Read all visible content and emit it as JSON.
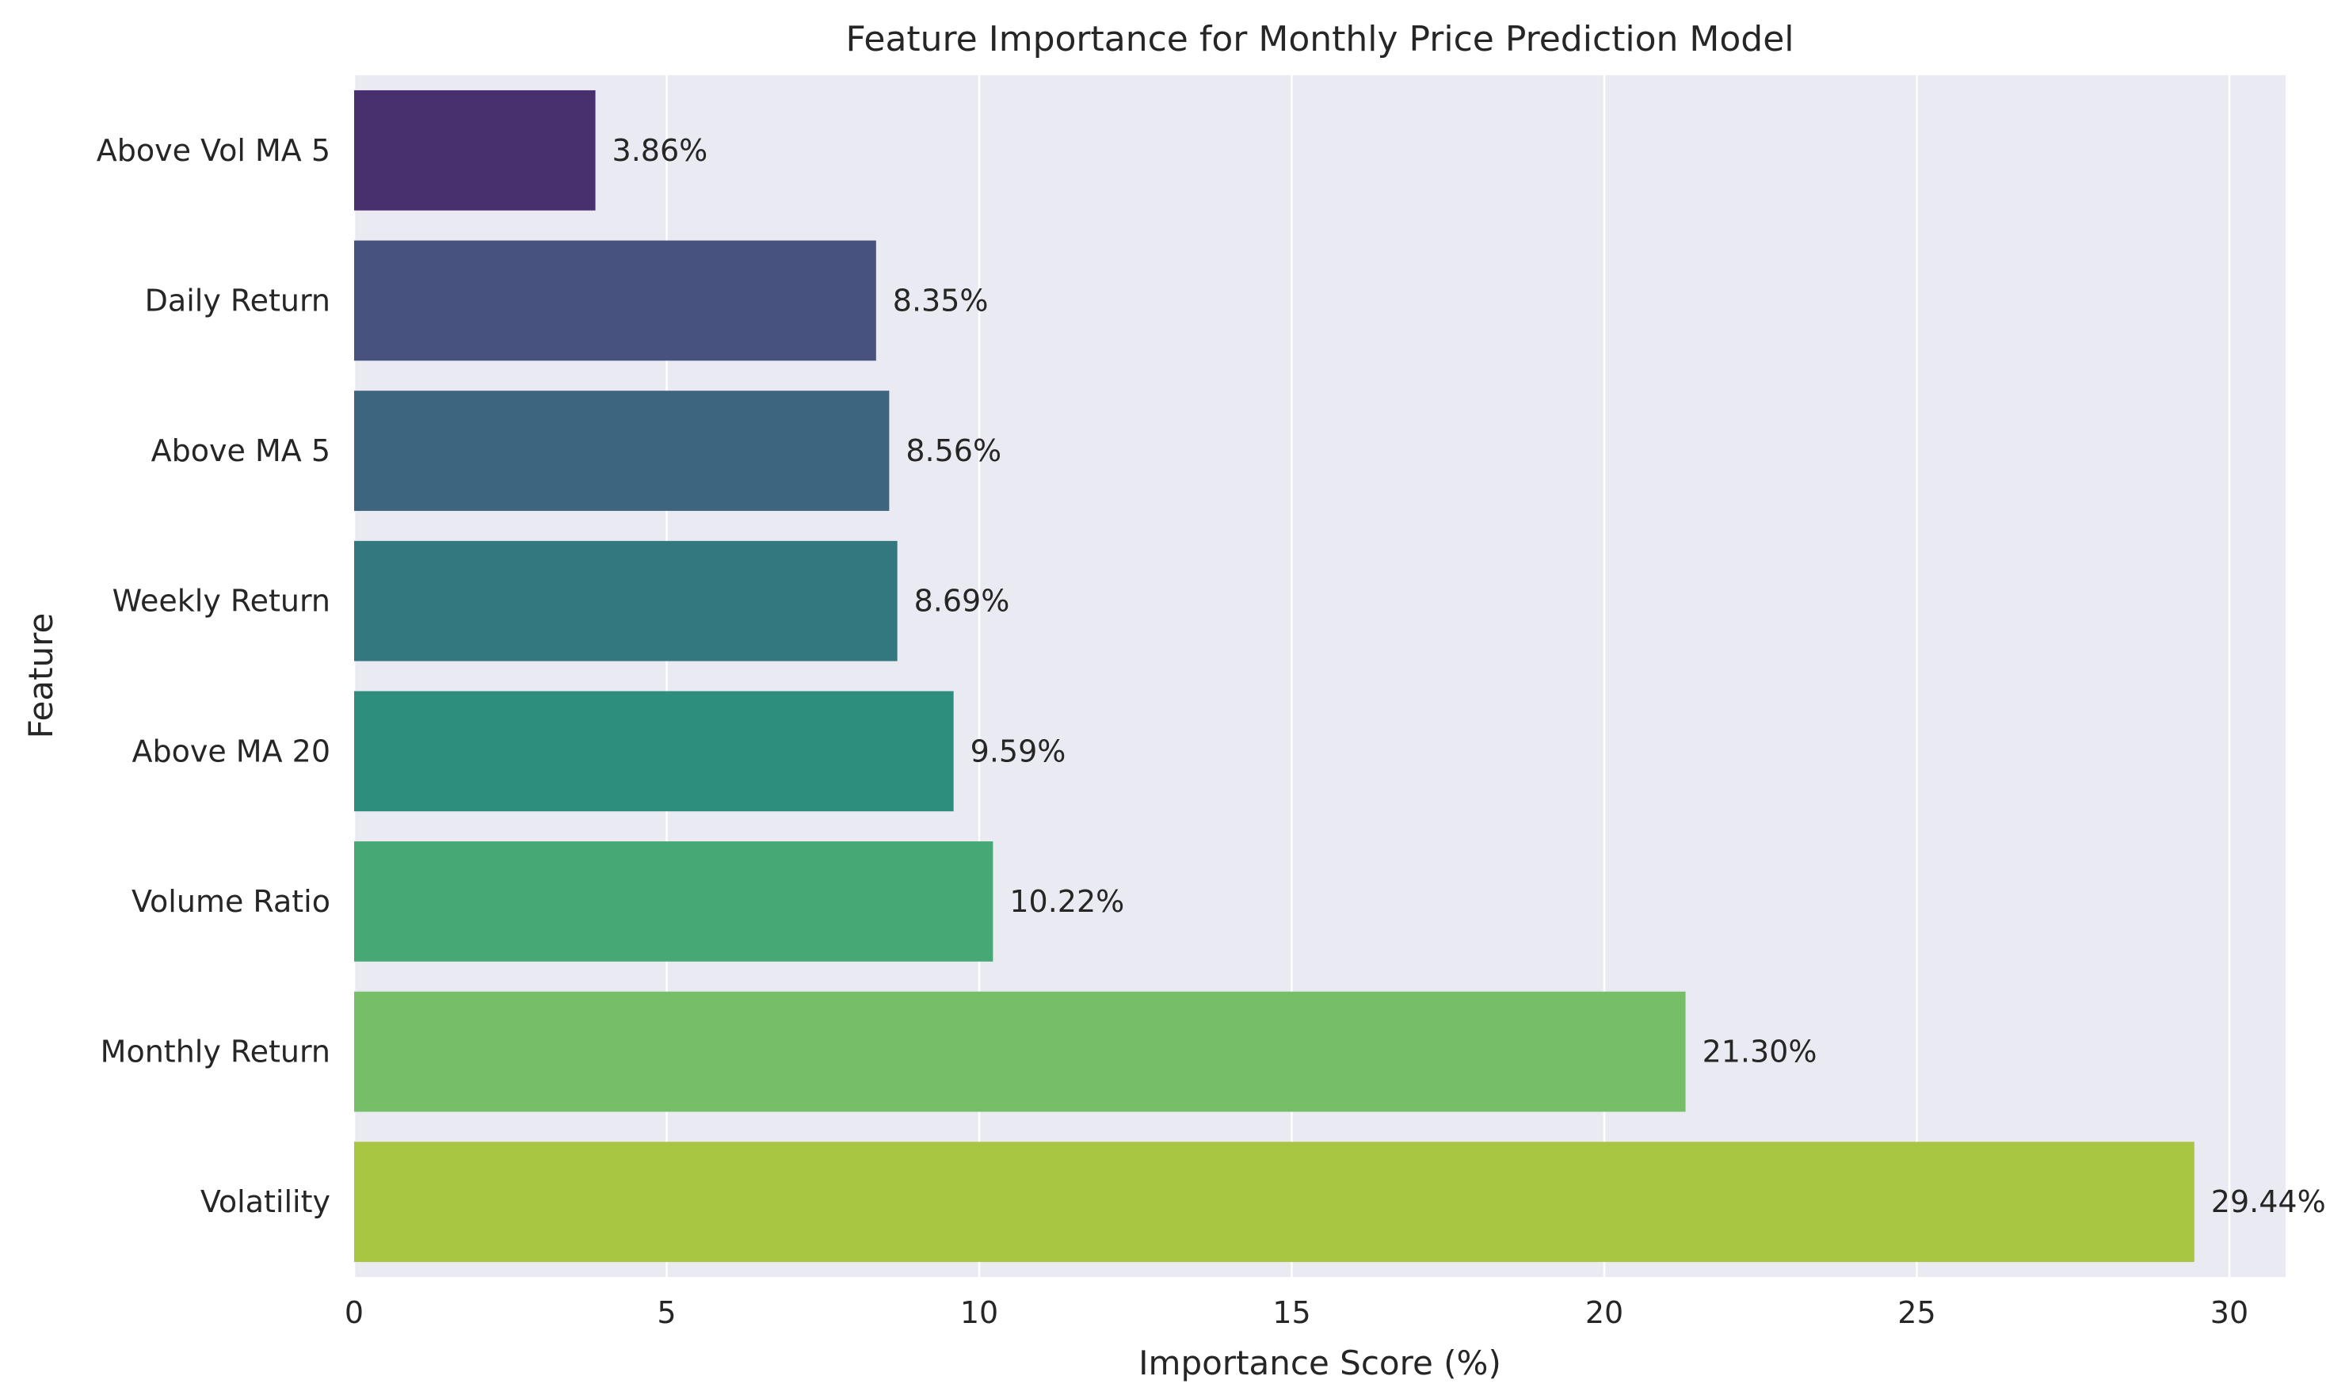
{
  "chart_data": {
    "type": "bar",
    "orientation": "horizontal",
    "title": "Feature Importance for Monthly Price Prediction Model",
    "xlabel": "Importance Score (%)",
    "ylabel": "Feature",
    "categories": [
      "Above Vol MA 5",
      "Daily Return",
      "Above MA 5",
      "Weekly Return",
      "Above MA 20",
      "Volume Ratio",
      "Monthly Return",
      "Volatility"
    ],
    "values": [
      3.86,
      8.35,
      8.56,
      8.69,
      9.59,
      10.22,
      21.3,
      29.44
    ],
    "data_labels": [
      "3.86%",
      "8.35%",
      "8.56%",
      "8.69%",
      "9.59%",
      "10.22%",
      "21.30%",
      "29.44%"
    ],
    "colors": [
      "#482f6d",
      "#47537e",
      "#3e6580",
      "#33777f",
      "#2e8e7e",
      "#46a875",
      "#76be67",
      "#a8c642"
    ],
    "xlim": [
      0,
      30.9
    ],
    "xticks": [
      0,
      5,
      10,
      15,
      20,
      25,
      30
    ],
    "xtick_labels": [
      "0",
      "5",
      "10",
      "15",
      "20",
      "25",
      "30"
    ],
    "grid": true,
    "style": "seaborn-darkgrid",
    "background": "#eaeaf2",
    "grid_color": "#ffffff",
    "legend": "none"
  }
}
